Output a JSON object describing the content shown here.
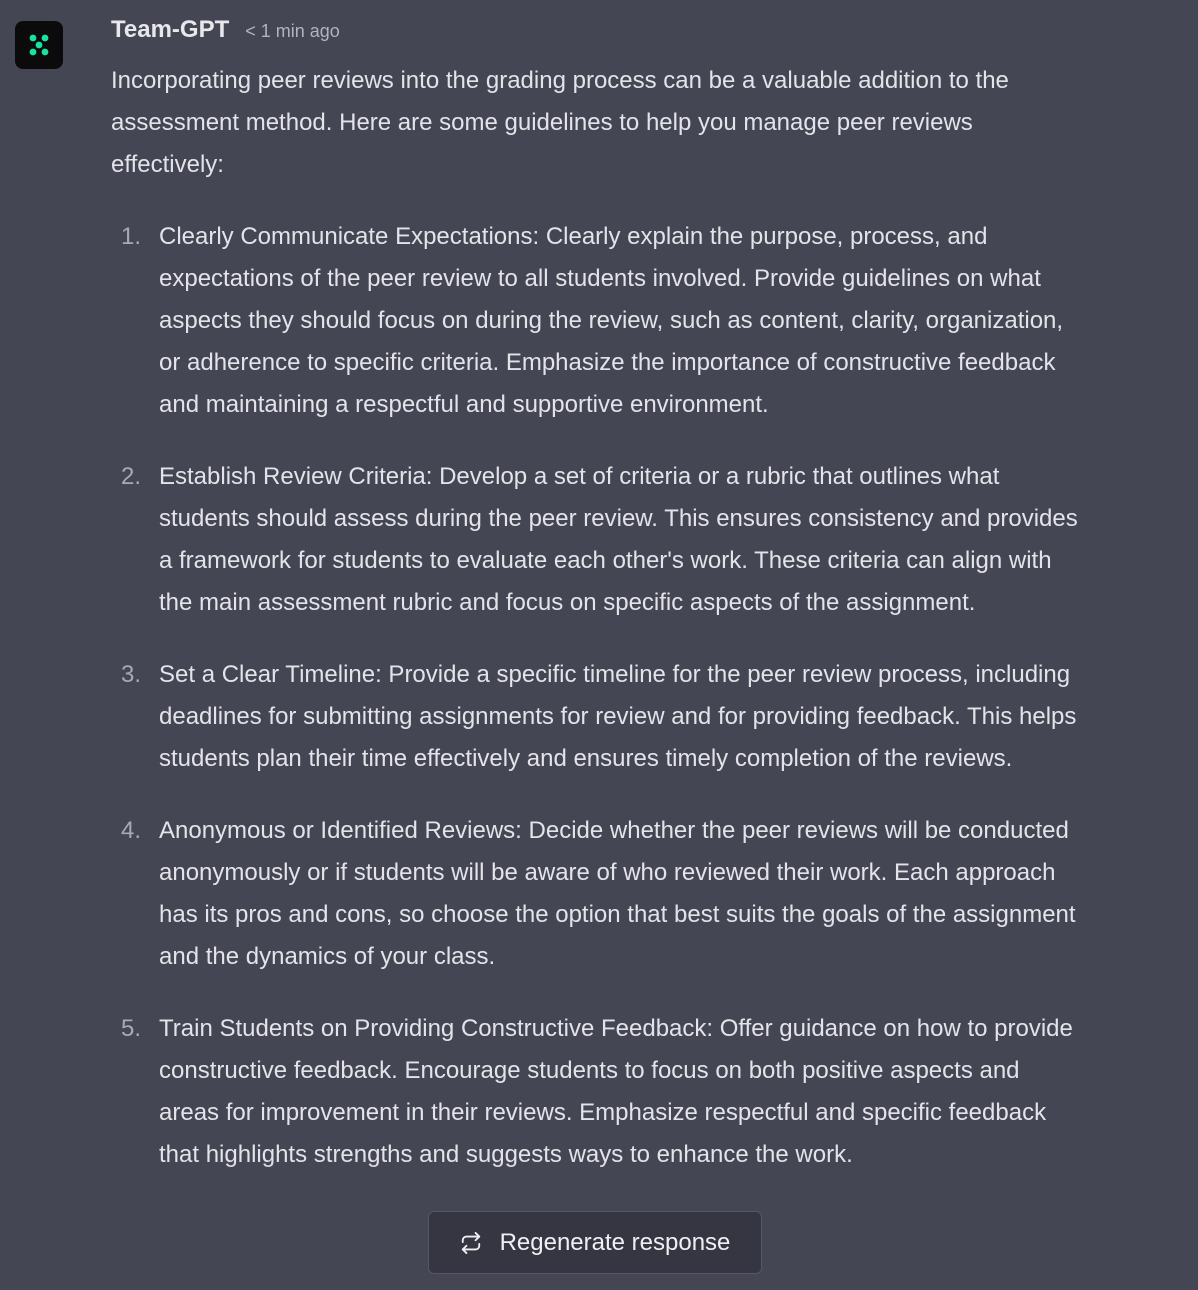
{
  "message": {
    "author": "Team-GPT",
    "timestamp": "< 1 min ago",
    "avatar_icon": "team-gpt-logo",
    "avatar_accent": "#19e3a3",
    "intro": "Incorporating peer reviews into the grading process can be a valuable addition to the assessment method. Here are some guidelines to help you manage peer reviews effectively:",
    "points": [
      {
        "number": "1.",
        "text": "Clearly Communicate Expectations: Clearly explain the purpose, process, and expectations of the peer review to all students involved. Provide guidelines on what aspects they should focus on during the review, such as content, clarity, organization, or adherence to specific criteria. Emphasize the importance of constructive feedback and maintaining a respectful and supportive environment."
      },
      {
        "number": "2.",
        "text": "Establish Review Criteria: Develop a set of criteria or a rubric that outlines what students should assess during the peer review. This ensures consistency and provides a framework for students to evaluate each other's work. These criteria can align with the main assessment rubric and focus on specific aspects of the assignment."
      },
      {
        "number": "3.",
        "text": "Set a Clear Timeline: Provide a specific timeline for the peer review process, including deadlines for submitting assignments for review and for providing feedback. This helps students plan their time effectively and ensures timely completion of the reviews."
      },
      {
        "number": "4.",
        "text": "Anonymous or Identified Reviews: Decide whether the peer reviews will be conducted anonymously or if students will be aware of who reviewed their work. Each approach has its pros and cons, so choose the option that best suits the goals of the assignment and the dynamics of your class."
      },
      {
        "number": "5.",
        "text": "Train Students on Providing Constructive Feedback: Offer guidance on how to provide constructive feedback. Encourage students to focus on both positive aspects and areas for improvement in their reviews. Emphasize respectful and specific feedback that highlights strengths and suggests ways to enhance the work."
      }
    ]
  },
  "actions": {
    "regenerate_label": "Regenerate response",
    "regenerate_icon": "refresh-icon"
  },
  "colors": {
    "background": "#444654",
    "button_background": "#353641"
  }
}
